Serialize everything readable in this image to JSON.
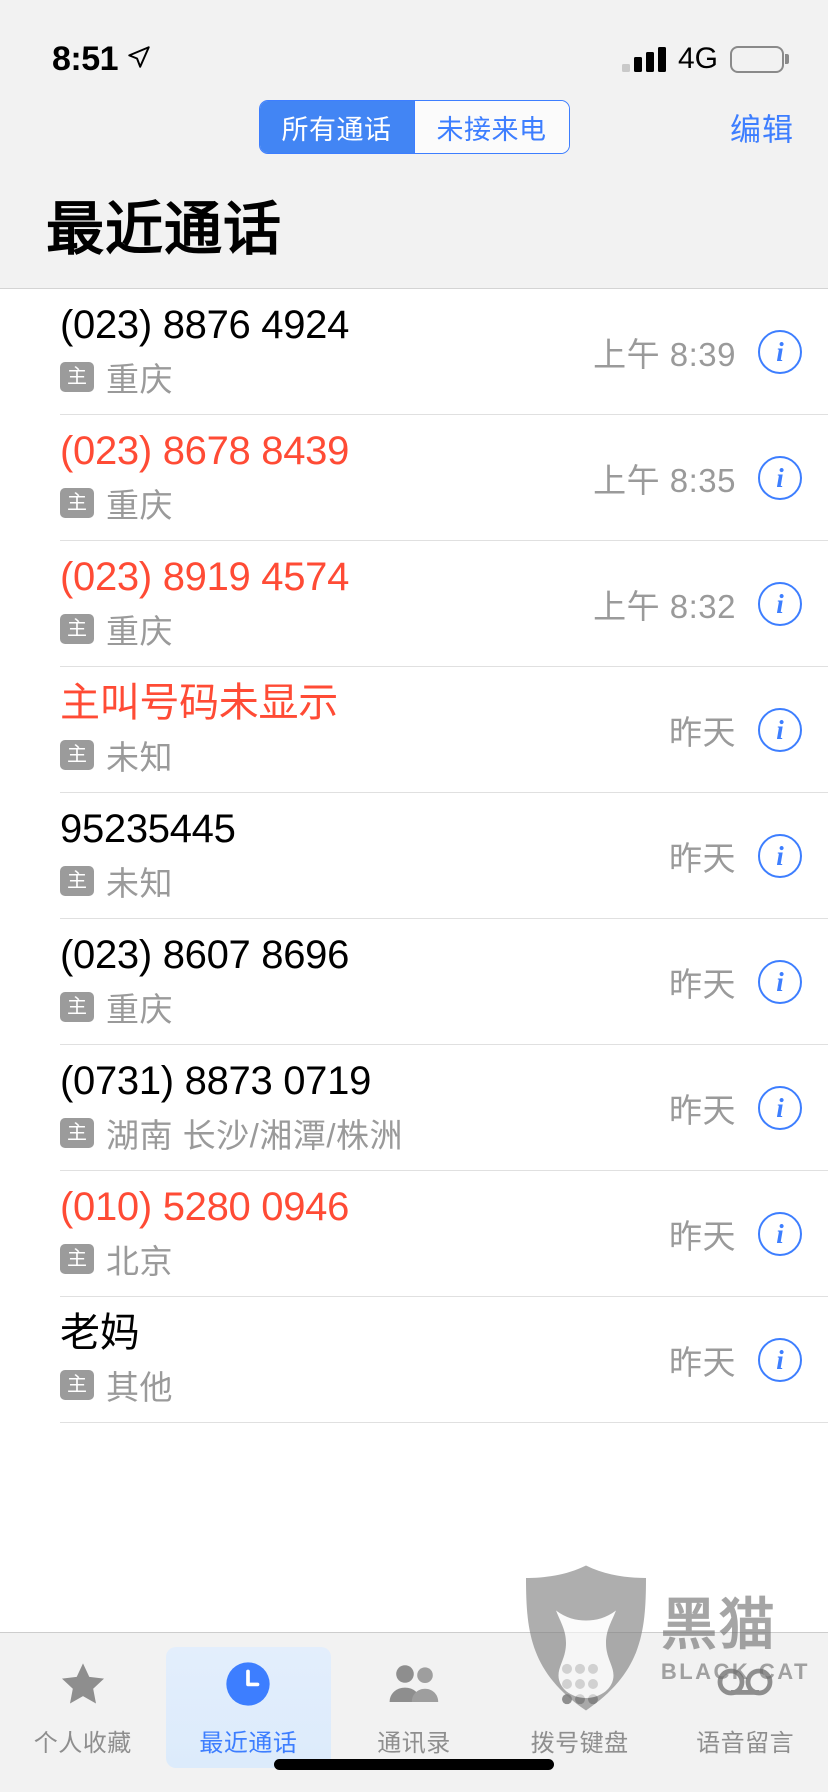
{
  "status_bar": {
    "time": "8:51",
    "location_icon": "location-arrow-icon",
    "signal_icon": "cellular-signal-icon",
    "network": "4G",
    "battery_icon": "battery-full-icon"
  },
  "nav": {
    "segments": [
      {
        "label": "所有通话",
        "active": true
      },
      {
        "label": "未接来电",
        "active": false
      }
    ],
    "edit_label": "编辑",
    "title": "最近通话"
  },
  "colors": {
    "accent_blue": "#3d7eff",
    "segment_active_bg": "#4285f4",
    "missed_red": "#ff4b35",
    "secondary_gray": "#9a9a9a",
    "badge_gray": "#9b9b9b",
    "bar_bg": "#f2f2f2"
  },
  "calls": [
    {
      "number": "(023) 8876 4924",
      "missed": false,
      "sim": "主",
      "location": "重庆",
      "time": "上午 8:39",
      "info": "i"
    },
    {
      "number": "(023) 8678 8439",
      "missed": true,
      "sim": "主",
      "location": "重庆",
      "time": "上午 8:35",
      "info": "i"
    },
    {
      "number": "(023) 8919 4574",
      "missed": true,
      "sim": "主",
      "location": "重庆",
      "time": "上午 8:32",
      "info": "i"
    },
    {
      "number": "主叫号码未显示",
      "missed": true,
      "sim": "主",
      "location": "未知",
      "time": "昨天",
      "info": "i"
    },
    {
      "number": "95235445",
      "missed": false,
      "sim": "主",
      "location": "未知",
      "time": "昨天",
      "info": "i"
    },
    {
      "number": "(023) 8607 8696",
      "missed": false,
      "sim": "主",
      "location": "重庆",
      "time": "昨天",
      "info": "i"
    },
    {
      "number": "(0731) 8873 0719",
      "missed": false,
      "sim": "主",
      "location": "湖南 长沙/湘潭/株洲",
      "time": "昨天",
      "info": "i"
    },
    {
      "number": "(010) 5280 0946",
      "missed": true,
      "sim": "主",
      "location": "北京",
      "time": "昨天",
      "info": "i"
    },
    {
      "number": "老妈",
      "missed": false,
      "sim": "主",
      "location": "其他",
      "time": "昨天",
      "info": "i"
    }
  ],
  "tabs": [
    {
      "label": "个人收藏",
      "icon": "star-icon",
      "active": false
    },
    {
      "label": "最近通话",
      "icon": "clock-icon",
      "active": true
    },
    {
      "label": "通讯录",
      "icon": "contacts-icon",
      "active": false
    },
    {
      "label": "拨号键盘",
      "icon": "keypad-icon",
      "active": false
    },
    {
      "label": "语音留言",
      "icon": "voicemail-icon",
      "active": false
    }
  ],
  "watermark": {
    "logo_icon": "black-cat-shield-logo",
    "cn": "黑猫",
    "en": "BLACK CAT"
  }
}
